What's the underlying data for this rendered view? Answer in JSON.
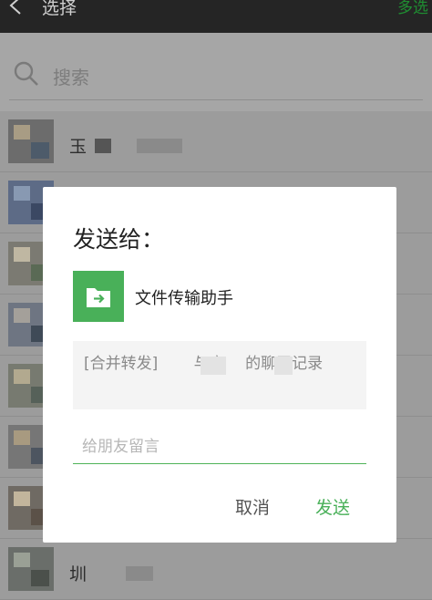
{
  "topbar": {
    "title": "选择",
    "multi_select": "多选"
  },
  "search": {
    "placeholder": "搜索"
  },
  "contacts": [
    {
      "name": "玉"
    },
    {
      "name": ""
    },
    {
      "name": ""
    },
    {
      "name": ""
    },
    {
      "name": ""
    },
    {
      "name": ""
    },
    {
      "name": ""
    },
    {
      "name": "圳"
    }
  ],
  "dialog": {
    "title": "发送给：",
    "target_name": "文件传输助手",
    "target_icon": "folder-arrow-icon",
    "preview_text": "[合并转发]　　 与启　 的聊天记录",
    "comment_placeholder": "给朋友留言",
    "cancel_label": "取消",
    "send_label": "发送"
  },
  "colors": {
    "accent": "#49b059",
    "topbar": "#252525",
    "overlay": "#9a9a9a"
  }
}
